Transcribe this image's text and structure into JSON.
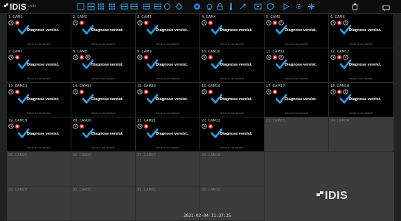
{
  "app": {
    "logo_text": "IDIS",
    "badge": "Lmtc",
    "datetime": "2021-02-04 11:37:25",
    "big_logo_text": "IDIS"
  },
  "toolbar_icons": [
    "single-layout-icon",
    "layout-2x2-icon",
    "layout-3x3-icon",
    "layout-4x4-icon",
    "layout-custom-icon",
    "layout-wide-icon",
    "layout-grid-icon",
    "layout-tile-icon",
    "layout-circle-icon",
    "layout-sequence-icon",
    "fullscreen-icon",
    "camera-status-icon",
    "lock-icon",
    "thermometer-icon",
    "draw-icon",
    "zoom-icon",
    "shield-icon",
    "play-icon",
    "settings-icon",
    "network-icon"
  ],
  "colors": {
    "accent": "#1e8fd6",
    "check": "#2b9be0",
    "status_red": "#d42b2b",
    "tile_empty": "#3b3b3b"
  },
  "status_text": {
    "diagnose": "Diagnose vereist.",
    "setup": "Setup is not loaded!"
  },
  "cameras": [
    {
      "name": "1. CAM1",
      "state": "diag",
      "extra": false
    },
    {
      "name": "2. CAM2",
      "state": "diag",
      "extra": false
    },
    {
      "name": "3. CAM3",
      "state": "diag",
      "extra": false
    },
    {
      "name": "4. CAM4",
      "state": "diag",
      "extra": false
    },
    {
      "name": "5. CAM5",
      "state": "diag",
      "extra": true
    },
    {
      "name": "6. CAM6",
      "state": "diag",
      "extra": true
    },
    {
      "name": "7. CAM7",
      "state": "diag",
      "extra": false
    },
    {
      "name": "8. CAM8",
      "state": "diag",
      "extra": true
    },
    {
      "name": "9. CAM9",
      "state": "diag",
      "extra": false
    },
    {
      "name": "10. CAM10",
      "state": "diag",
      "extra": false
    },
    {
      "name": "11. CAM11",
      "state": "diag",
      "extra": true
    },
    {
      "name": "12. CAM12",
      "state": "diag",
      "extra": true
    },
    {
      "name": "13. CAM13",
      "state": "diag",
      "extra": false
    },
    {
      "name": "14. CAM14",
      "state": "diag",
      "extra": false
    },
    {
      "name": "15. CAM15",
      "state": "diag",
      "extra": false
    },
    {
      "name": "16. CAM16",
      "state": "diag",
      "extra": false
    },
    {
      "name": "17. CAM17",
      "state": "diag",
      "extra": false
    },
    {
      "name": "18. CAM18",
      "state": "diag",
      "extra": true
    },
    {
      "name": "19. CAM19",
      "state": "diag",
      "extra": false
    },
    {
      "name": "20. CAM20",
      "state": "diag",
      "extra": false
    },
    {
      "name": "21. CAM21",
      "state": "diag",
      "extra": false
    },
    {
      "name": "22. CAM22",
      "state": "diag",
      "extra": false
    },
    {
      "name": "23. CAM23",
      "state": "empty",
      "extra": false
    },
    {
      "name": "24. CAM24",
      "state": "empty",
      "extra": false
    },
    {
      "name": "25. CAM25",
      "state": "empty",
      "extra": false
    },
    {
      "name": "26. CAM26",
      "state": "empty",
      "extra": false
    },
    {
      "name": "27. CAM27",
      "state": "empty",
      "extra": false
    },
    {
      "name": "28. CAM28",
      "state": "empty",
      "extra": false
    },
    {
      "name": "29. CAM29",
      "state": "empty",
      "extra": false
    },
    {
      "name": "30. CAM30",
      "state": "empty",
      "extra": false
    },
    {
      "name": "31. CAM31",
      "state": "empty",
      "extra": false
    },
    {
      "name": "32. CAM32",
      "state": "empty",
      "extra": false
    }
  ]
}
